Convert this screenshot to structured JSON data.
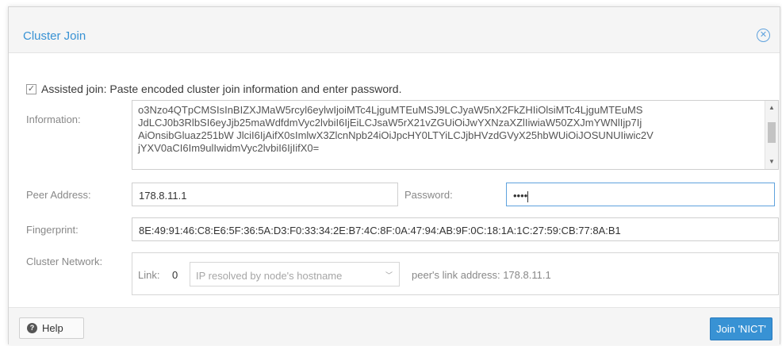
{
  "dialog": {
    "title": "Cluster Join",
    "close_icon": "close-icon",
    "assisted_label": "Assisted join: Paste encoded cluster join information and enter password.",
    "assisted_checked": true,
    "information_label": "Information:",
    "information_value": "o3Nzo4QTpCMSIsInBIZXJMaW5rcyl6eylwIjoiMTc4LjguMTEuMSJ9LCJyaW5nX2FkZHIiOlsiMTc4LjguMTEuMS\nJdLCJ0b3RlbSI6eyJjb25maWdfdmVyc2lvbiI6IjEiLCJsaW5rX21vZGUiOiJwYXNzaXZlIiwiaW50ZXJmYWNlIjp7Ij\nAiOnsibGluaz251bW JlciI6IjAifX0sImlwX3ZlcnNpb24iOiJpcHY0LTYiLCJjbHVzdGVyX25hbWUiOiJOSUNUIiwic2V\njYXV0aCI6Im9ulIwidmVyc2lvbiI6IjIifX0=",
    "peer_address_label": "Peer Address:",
    "peer_address_value": "178.8.11.1",
    "password_label": "Password:",
    "password_value": "••••",
    "fingerprint_label": "Fingerprint:",
    "fingerprint_value": "8E:49:91:46:C8:E6:5F:36:5A:D3:F0:33:34:2E:B7:4C:8F:0A:47:94:AB:9F:0C:18:1A:1C:27:59:CB:77:8A:B1",
    "cluster_network_label": "Cluster Network:",
    "link_label": "Link:",
    "link_number": "0",
    "link_select_placeholder": "IP resolved by node's hostname",
    "peer_link_text": "peer's link address: 178.8.11.1",
    "help_label": "Help",
    "join_label": "Join 'NICT'"
  },
  "colors": {
    "accent": "#3892d4",
    "header_bg": "#f5f5f5",
    "label_gray": "#888888"
  }
}
